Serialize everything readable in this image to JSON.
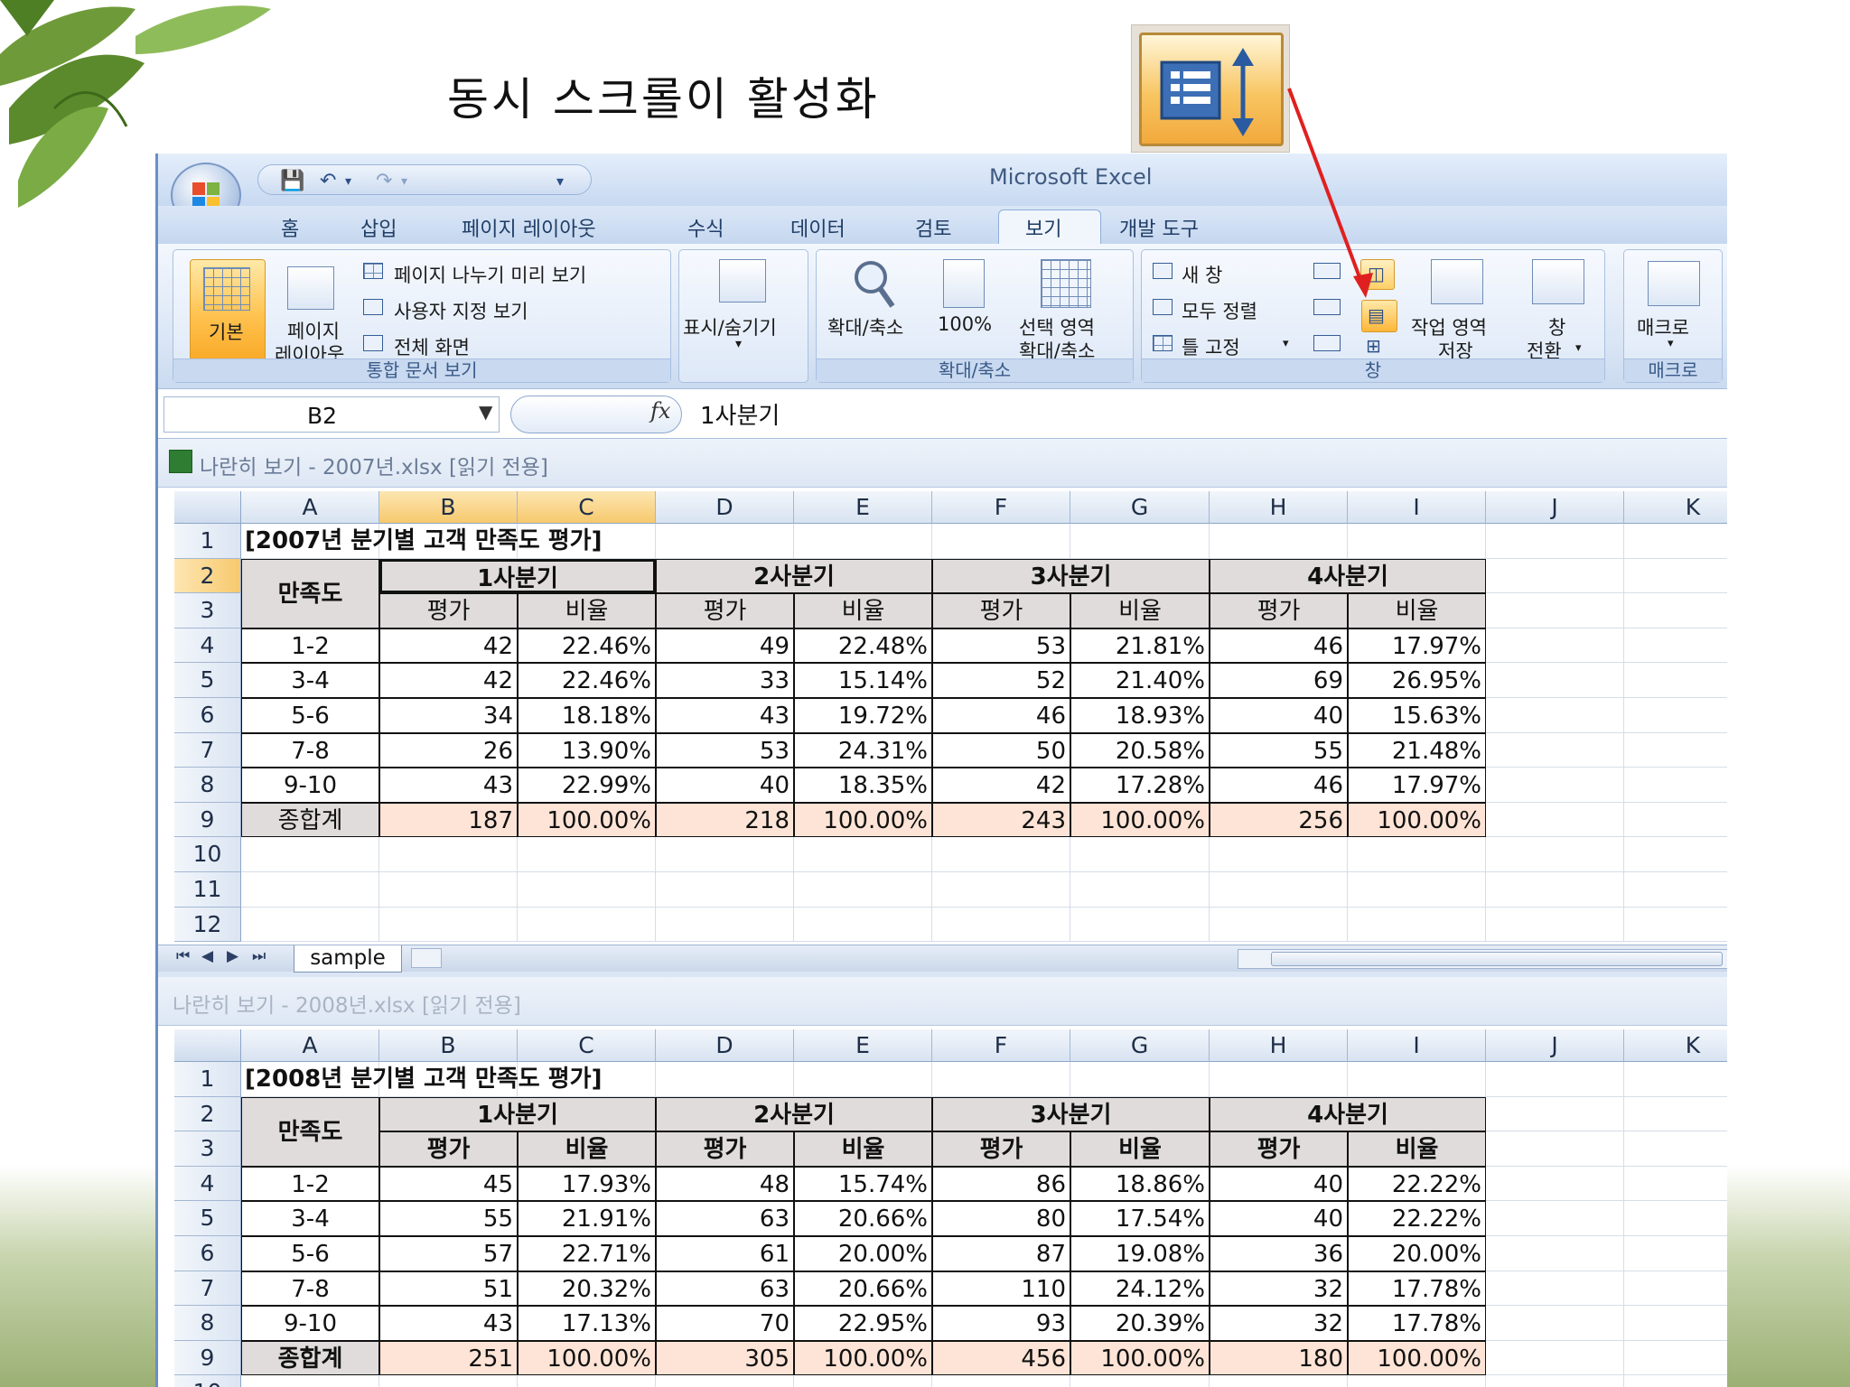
{
  "slide": {
    "title": "동시 스크롤이 활성화"
  },
  "excel": {
    "app_title": "Microsoft Excel",
    "tabs": [
      "홈",
      "삽입",
      "페이지 레이아웃",
      "수식",
      "데이터",
      "검토",
      "보기",
      "개발 도구"
    ],
    "active_tab": "보기",
    "ribbon": {
      "group1": {
        "label": "통합 문서 보기",
        "normal": "기본",
        "page_layout_1": "페이지",
        "page_layout_2": "레이아웃",
        "page_break": "페이지 나누기 미리 보기",
        "custom_views": "사용자 지정 보기",
        "full_screen": "전체 화면"
      },
      "group2": {
        "label": "표시/숨기기"
      },
      "group3": {
        "label": "확대/축소",
        "zoom": "확대/축소",
        "zoom100": "100%",
        "zoom_sel_1": "선택 영역",
        "zoom_sel_2": "확대/축소"
      },
      "group4": {
        "label": "창",
        "new_window": "새 창",
        "arrange_all": "모두 정렬",
        "freeze_panes": "틀 고정",
        "save_ws_1": "작업 영역",
        "save_ws_2": "저장",
        "switch_1": "창",
        "switch_2": "전환"
      },
      "group5": {
        "label": "매크로",
        "macros": "매크로"
      }
    },
    "formula_bar": {
      "name_box": "B2",
      "fx": "fx",
      "value": "1사분기"
    },
    "columns": [
      "A",
      "B",
      "C",
      "D",
      "E",
      "F",
      "G",
      "H",
      "I",
      "J",
      "K"
    ],
    "workbooks": [
      {
        "title": "나란히 보기 - 2007년.xlsx  [읽기 전용]",
        "sheet_title": "[2007년 분기별 고객 만족도 평가]",
        "label_col": "만족도",
        "quarters": [
          "1사분기",
          "2사분기",
          "3사분기",
          "4사분기"
        ],
        "sub": [
          "평가",
          "비율"
        ],
        "rows": [
          [
            "1-2",
            "42",
            "22.46%",
            "49",
            "22.48%",
            "53",
            "21.81%",
            "46",
            "17.97%"
          ],
          [
            "3-4",
            "42",
            "22.46%",
            "33",
            "15.14%",
            "52",
            "21.40%",
            "69",
            "26.95%"
          ],
          [
            "5-6",
            "34",
            "18.18%",
            "43",
            "19.72%",
            "46",
            "18.93%",
            "40",
            "15.63%"
          ],
          [
            "7-8",
            "26",
            "13.90%",
            "53",
            "24.31%",
            "50",
            "20.58%",
            "55",
            "21.48%"
          ],
          [
            "9-10",
            "43",
            "22.99%",
            "40",
            "18.35%",
            "42",
            "17.28%",
            "46",
            "17.97%"
          ],
          [
            "종합계",
            "187",
            "100.00%",
            "218",
            "100.00%",
            "243",
            "100.00%",
            "256",
            "100.00%"
          ]
        ],
        "sheet_tab": "sample"
      },
      {
        "title": "나란히 보기 - 2008년.xlsx  [읽기 전용]",
        "sheet_title": "[2008년 분기별 고객 만족도 평가]",
        "label_col": "만족도",
        "quarters": [
          "1사분기",
          "2사분기",
          "3사분기",
          "4사분기"
        ],
        "sub": [
          "평가",
          "비율"
        ],
        "rows": [
          [
            "1-2",
            "45",
            "17.93%",
            "48",
            "15.74%",
            "86",
            "18.86%",
            "40",
            "22.22%"
          ],
          [
            "3-4",
            "55",
            "21.91%",
            "63",
            "20.66%",
            "80",
            "17.54%",
            "40",
            "22.22%"
          ],
          [
            "5-6",
            "57",
            "22.71%",
            "61",
            "20.00%",
            "87",
            "19.08%",
            "36",
            "20.00%"
          ],
          [
            "7-8",
            "51",
            "20.32%",
            "63",
            "20.66%",
            "110",
            "24.12%",
            "32",
            "17.78%"
          ],
          [
            "9-10",
            "43",
            "17.13%",
            "70",
            "22.95%",
            "93",
            "20.39%",
            "32",
            "17.78%"
          ],
          [
            "종합계",
            "251",
            "100.00%",
            "305",
            "100.00%",
            "456",
            "100.00%",
            "180",
            "100.00%"
          ]
        ]
      }
    ],
    "colors": {
      "selected_header": "#f7c96d",
      "total_fill": "#fde4d6",
      "header_fill": "#e0dcdc",
      "arrow": "#e02020"
    }
  }
}
